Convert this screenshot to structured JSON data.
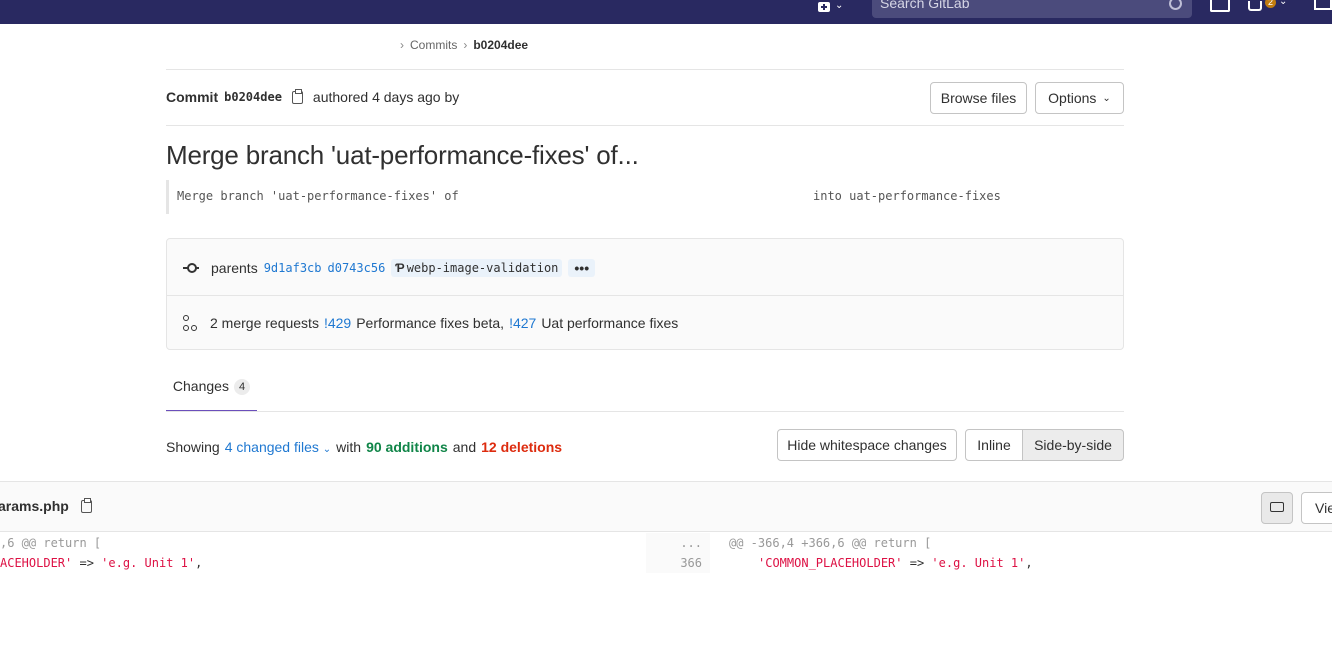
{
  "nav": {
    "search_placeholder": "Search GitLab",
    "mr_count": "2"
  },
  "breadcrumb": {
    "items": [
      "Commits",
      "b0204dee"
    ]
  },
  "commit": {
    "label": "Commit",
    "sha": "b0204dee",
    "authored_text": "authored 4 days ago by",
    "browse_files": "Browse files",
    "options": "Options",
    "title": "Merge branch 'uat-performance-fixes' of...",
    "description_left": "Merge branch 'uat-performance-fixes' of",
    "description_right": "into uat-performance-fixes",
    "parents_label": "parents",
    "parent_1": "9d1af3cb",
    "parent_2": "d0743c56",
    "branch": "webp-image-validation",
    "more": "•••",
    "mr_text": "2 merge requests",
    "mr_1_ref": "!429",
    "mr_1_title": "Performance fixes beta,",
    "mr_2_ref": "!427",
    "mr_2_title": "Uat performance fixes"
  },
  "tabs": {
    "changes_label": "Changes",
    "changes_count": "4"
  },
  "stats": {
    "showing": "Showing",
    "files": "4 changed files",
    "with": "with",
    "additions": "90 additions",
    "and": "and",
    "deletions": "12 deletions"
  },
  "diff_controls": {
    "hide_whitespace": "Hide whitespace changes",
    "inline": "Inline",
    "side_by_side": "Side-by-side",
    "view": "Vie"
  },
  "file": {
    "name": "arams.php",
    "left_hunk": ",6 @@ return [",
    "left_key": "ACEHOLDER'",
    "left_arrow": "=>",
    "left_val": "'e.g. Unit 1'",
    "left_comma": ",",
    "ellipsis": "...",
    "line_no": "366",
    "right_hunk": "@@ -366,4 +366,6 @@ return [",
    "right_key": "'COMMON_PLACEHOLDER'",
    "right_arrow": "=>",
    "right_val": "'e.g. Unit 1'",
    "right_comma": ","
  },
  "colors": {
    "navbar": "#292961",
    "link": "#1f78d1",
    "additions": "#108548",
    "deletions": "#dd2b0e",
    "tab_active": "#6b4fbb"
  }
}
